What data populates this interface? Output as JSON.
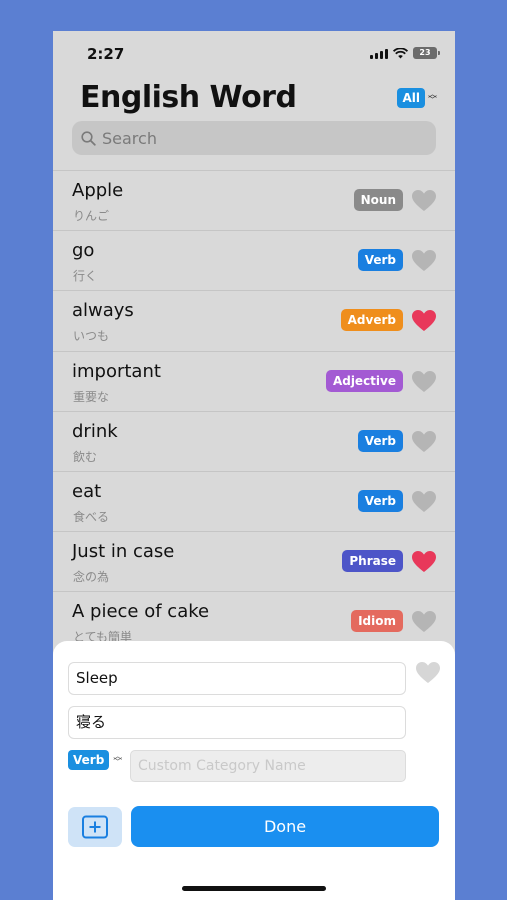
{
  "status": {
    "time": "2:27",
    "battery": "23"
  },
  "header": {
    "title": "English Word",
    "filter_label": "All"
  },
  "search": {
    "placeholder": "Search"
  },
  "colors": {
    "noun": "#8a8a8a",
    "verb": "#1a7fe0",
    "adverb": "#ef8e1c",
    "adjective": "#a35ad3",
    "phrase": "#4d55c8",
    "idiom": "#e46a5e",
    "heart_on": "#e8385a",
    "heart_off": "#b5b5b5"
  },
  "words": [
    {
      "word": "Apple",
      "meaning": "りんご",
      "category": "Noun",
      "favorite": false
    },
    {
      "word": "go",
      "meaning": "行く",
      "category": "Verb",
      "favorite": false
    },
    {
      "word": "always",
      "meaning": "いつも",
      "category": "Adverb",
      "favorite": true
    },
    {
      "word": "important",
      "meaning": "重要な",
      "category": "Adjective",
      "favorite": false
    },
    {
      "word": "drink",
      "meaning": "飲む",
      "category": "Verb",
      "favorite": false
    },
    {
      "word": "eat",
      "meaning": "食べる",
      "category": "Verb",
      "favorite": false
    },
    {
      "word": "Just in case",
      "meaning": "念の為",
      "category": "Phrase",
      "favorite": true
    },
    {
      "word": "A piece of cake",
      "meaning": "とても簡単",
      "category": "Idiom",
      "favorite": false
    }
  ],
  "editor": {
    "word_value": "Sleep",
    "meaning_value": "寝る",
    "category_label": "Verb",
    "custom_placeholder": "Custom Category Name",
    "done_label": "Done"
  }
}
